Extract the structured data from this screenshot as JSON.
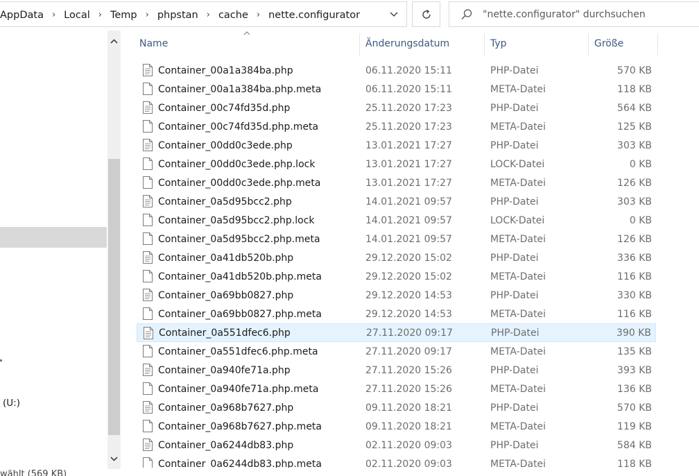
{
  "address_bar": {
    "breadcrumbs": [
      "AppData",
      "Local",
      "Temp",
      "phpstan",
      "cache",
      "nette.configurator"
    ]
  },
  "search": {
    "placeholder": "\"nette.configurator\" durchsuchen"
  },
  "nav_pane": {
    "drive_label": "(U:)"
  },
  "columns": {
    "name": "Name",
    "date": "Änderungsdatum",
    "type": "Typ",
    "size": "Größe"
  },
  "files": [
    {
      "name": "Container_00a1a384ba.php",
      "date": "06.11.2020 15:11",
      "type": "PHP-Datei",
      "size": "570 KB",
      "icon": "php-file-icon"
    },
    {
      "name": "Container_00a1a384ba.php.meta",
      "date": "06.11.2020 15:11",
      "type": "META-Datei",
      "size": "118 KB",
      "icon": "generic-file-icon"
    },
    {
      "name": "Container_00c74fd35d.php",
      "date": "25.11.2020 17:23",
      "type": "PHP-Datei",
      "size": "564 KB",
      "icon": "php-file-icon"
    },
    {
      "name": "Container_00c74fd35d.php.meta",
      "date": "25.11.2020 17:23",
      "type": "META-Datei",
      "size": "125 KB",
      "icon": "generic-file-icon"
    },
    {
      "name": "Container_00dd0c3ede.php",
      "date": "13.01.2021 17:27",
      "type": "PHP-Datei",
      "size": "303 KB",
      "icon": "php-file-icon"
    },
    {
      "name": "Container_00dd0c3ede.php.lock",
      "date": "13.01.2021 17:27",
      "type": "LOCK-Datei",
      "size": "0 KB",
      "icon": "generic-file-icon"
    },
    {
      "name": "Container_00dd0c3ede.php.meta",
      "date": "13.01.2021 17:27",
      "type": "META-Datei",
      "size": "126 KB",
      "icon": "generic-file-icon"
    },
    {
      "name": "Container_0a5d95bcc2.php",
      "date": "14.01.2021 09:57",
      "type": "PHP-Datei",
      "size": "303 KB",
      "icon": "php-file-icon"
    },
    {
      "name": "Container_0a5d95bcc2.php.lock",
      "date": "14.01.2021 09:57",
      "type": "LOCK-Datei",
      "size": "0 KB",
      "icon": "generic-file-icon"
    },
    {
      "name": "Container_0a5d95bcc2.php.meta",
      "date": "14.01.2021 09:57",
      "type": "META-Datei",
      "size": "126 KB",
      "icon": "generic-file-icon"
    },
    {
      "name": "Container_0a41db520b.php",
      "date": "29.12.2020 15:02",
      "type": "PHP-Datei",
      "size": "336 KB",
      "icon": "php-file-icon"
    },
    {
      "name": "Container_0a41db520b.php.meta",
      "date": "29.12.2020 15:02",
      "type": "META-Datei",
      "size": "116 KB",
      "icon": "generic-file-icon"
    },
    {
      "name": "Container_0a69bb0827.php",
      "date": "29.12.2020 14:53",
      "type": "PHP-Datei",
      "size": "330 KB",
      "icon": "php-file-icon"
    },
    {
      "name": "Container_0a69bb0827.php.meta",
      "date": "29.12.2020 14:53",
      "type": "META-Datei",
      "size": "116 KB",
      "icon": "generic-file-icon"
    },
    {
      "name": "Container_0a551dfec6.php",
      "date": "27.11.2020 09:17",
      "type": "PHP-Datei",
      "size": "390 KB",
      "icon": "php-file-icon",
      "hovered": true
    },
    {
      "name": "Container_0a551dfec6.php.meta",
      "date": "27.11.2020 09:17",
      "type": "META-Datei",
      "size": "135 KB",
      "icon": "generic-file-icon"
    },
    {
      "name": "Container_0a940fe71a.php",
      "date": "27.11.2020 15:26",
      "type": "PHP-Datei",
      "size": "393 KB",
      "icon": "php-file-icon"
    },
    {
      "name": "Container_0a940fe71a.php.meta",
      "date": "27.11.2020 15:26",
      "type": "META-Datei",
      "size": "136 KB",
      "icon": "generic-file-icon"
    },
    {
      "name": "Container_0a968b7627.php",
      "date": "09.11.2020 18:21",
      "type": "PHP-Datei",
      "size": "570 KB",
      "icon": "php-file-icon"
    },
    {
      "name": "Container_0a968b7627.php.meta",
      "date": "09.11.2020 18:21",
      "type": "META-Datei",
      "size": "119 KB",
      "icon": "generic-file-icon"
    },
    {
      "name": "Container_0a6244db83.php",
      "date": "02.11.2020 09:03",
      "type": "PHP-Datei",
      "size": "584 KB",
      "icon": "php-file-icon"
    },
    {
      "name": "Container_0a6244db83.php.meta",
      "date": "02.11.2020 09:03",
      "type": "META-Datei",
      "size": "118 KB",
      "icon": "generic-file-icon"
    }
  ],
  "status_bar": {
    "text": "wählt (569 KB)"
  },
  "colors": {
    "hover_bg": "#e5f3ff",
    "header_text": "#3d5a7e",
    "selected_nav": "#d9d9d9"
  }
}
